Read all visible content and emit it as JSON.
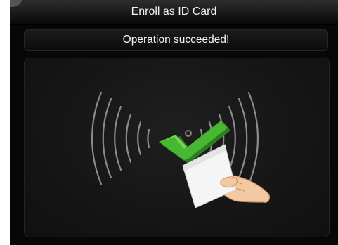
{
  "header": {
    "title": "Enroll as ID Card"
  },
  "status": {
    "message": "Operation succeeded!",
    "state": "success"
  },
  "illustration": {
    "icons": [
      "rfid-wave-icon",
      "success-checkmark-icon",
      "id-card-icon",
      "hand-icon"
    ],
    "colors": {
      "checkmark": "#3fae2a",
      "card": "#f5f5f5",
      "hand": "#f3c9a4",
      "waves": "#8c8c8c"
    }
  }
}
